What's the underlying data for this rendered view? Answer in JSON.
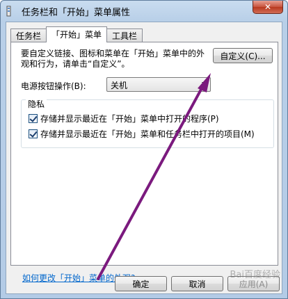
{
  "window": {
    "title": "任务栏和「开始」菜单属性",
    "close_label": "✕"
  },
  "tabs": [
    {
      "label": "任务栏",
      "active": false
    },
    {
      "label": "「开始」菜单",
      "active": true
    },
    {
      "label": "工具栏",
      "active": false
    }
  ],
  "start_menu": {
    "description": "要自定义链接、图标和菜单在「开始」菜单中的外观和行为，请单击“自定义”。",
    "customize_button": "自定义(C)...",
    "power_label": "电源按钮操作(B):",
    "power_value": "关机",
    "privacy": {
      "label": "隐私",
      "options": [
        {
          "label": "存储并显示最近在「开始」菜单中打开的程序(P)",
          "checked": true
        },
        {
          "label": "存储并显示最近在「开始」菜单和任务栏中打开的项目(M)",
          "checked": true
        }
      ]
    },
    "help_link": "如何更改「开始」菜单的外观?"
  },
  "footer": {
    "ok": "确定",
    "cancel": "取消",
    "apply": "应用(A)"
  },
  "watermark": "Bai百度经验",
  "colors": {
    "annotation_arrow": "#7b1a7e",
    "link": "#0066cc"
  }
}
